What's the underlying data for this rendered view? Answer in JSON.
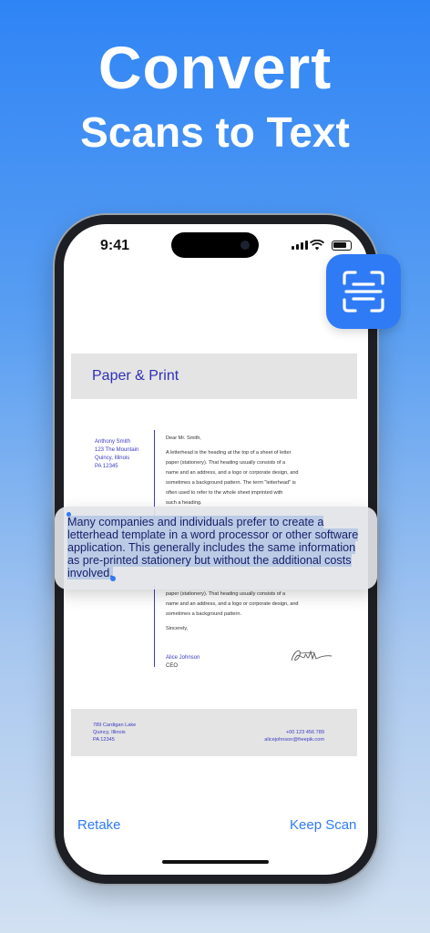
{
  "headline": {
    "line1": "Convert",
    "line2": "Scans to Text"
  },
  "status_bar": {
    "time": "9:41"
  },
  "document": {
    "title": "Paper & Print",
    "sender": [
      "Anthony Smith",
      "123 The Mountain",
      "Quincy, Illinois",
      "PA 12345"
    ],
    "greeting": "Dear Mr. Smith,",
    "paragraph1": [
      "A letterhead is the heading at the top of a sheet of letter",
      "paper (stationery). That heading usually consists of a",
      "name and an address, and a logo or corporate design, and",
      "sometimes a background pattern. The term \"letterhead\" is",
      "often used to refer to the whole sheet imprinted with",
      "such a heading."
    ],
    "paragraph2": [
      "paper (stationery). That heading usually consists of a",
      "name and an address, and a logo or corporate design, and",
      "sometimes a background pattern."
    ],
    "closing": "Sincerely,",
    "signer_name": "Alice Johnson",
    "signer_role": "CEO",
    "footer_address": [
      "789 Cardigan Lake",
      "Quincy, Illinois",
      "PA 12345"
    ],
    "footer_phone": "+00 123 456 789",
    "footer_email": "alicejohnson@freepik.com"
  },
  "selection": {
    "text": "Many companies and individuals prefer to create a letterhead template in a word processor or other software application. This generally includes the same information as pre-printed stationery but without the additional costs involved."
  },
  "buttons": {
    "retake": "Retake",
    "keep_scan": "Keep Scan"
  },
  "icons": {
    "scan_text": "text-scan-icon"
  },
  "colors": {
    "accent": "#2f7bf5",
    "doc_text_blue": "#3b3bc4"
  }
}
